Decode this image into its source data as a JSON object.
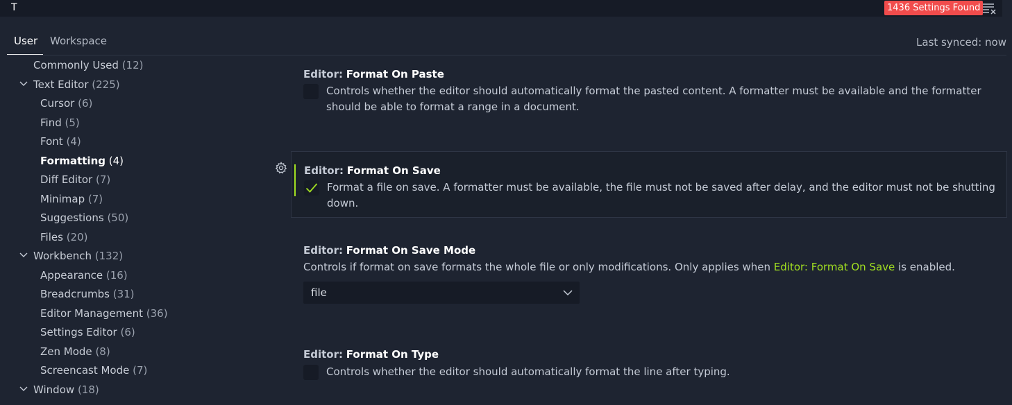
{
  "search": {
    "value": "T",
    "results_badge": "1436 Settings Found"
  },
  "tabs": {
    "user": "User",
    "workspace": "Workspace",
    "sync_status": "Last synced: now"
  },
  "toc": [
    {
      "label": "Commonly Used",
      "count": "(12)"
    },
    {
      "label": "Text Editor",
      "count": "(225)",
      "expanded": true
    },
    {
      "label": "Cursor",
      "count": "(6)"
    },
    {
      "label": "Find",
      "count": "(5)"
    },
    {
      "label": "Font",
      "count": "(4)"
    },
    {
      "label": "Formatting",
      "count": "(4)",
      "active": true
    },
    {
      "label": "Diff Editor",
      "count": "(7)"
    },
    {
      "label": "Minimap",
      "count": "(7)"
    },
    {
      "label": "Suggestions",
      "count": "(50)"
    },
    {
      "label": "Files",
      "count": "(20)"
    },
    {
      "label": "Workbench",
      "count": "(132)",
      "expanded": true
    },
    {
      "label": "Appearance",
      "count": "(16)"
    },
    {
      "label": "Breadcrumbs",
      "count": "(31)"
    },
    {
      "label": "Editor Management",
      "count": "(36)"
    },
    {
      "label": "Settings Editor",
      "count": "(6)"
    },
    {
      "label": "Zen Mode",
      "count": "(8)"
    },
    {
      "label": "Screencast Mode",
      "count": "(7)"
    },
    {
      "label": "Window",
      "count": "(18)",
      "expanded": true
    }
  ],
  "settings": {
    "format_on_paste": {
      "category": "Editor:",
      "name": "Format On Paste",
      "description": "Controls whether the editor should automatically format the pasted content. A formatter must be available and the formatter should be able to format a range in a document.",
      "checked": false
    },
    "format_on_save": {
      "category": "Editor:",
      "name": "Format On Save",
      "description": "Format a file on save. A formatter must be available, the file must not be saved after delay, and the editor must not be shutting down.",
      "checked": true
    },
    "format_on_save_mode": {
      "category": "Editor:",
      "name": "Format On Save Mode",
      "description_before": "Controls if format on save formats the whole file or only modifications. Only applies when",
      "description_link": "Editor: Format On Save",
      "description_after": "is enabled.",
      "value": "file"
    },
    "format_on_type": {
      "category": "Editor:",
      "name": "Format On Type",
      "description": "Controls whether the editor should automatically format the line after typing.",
      "checked": false
    }
  },
  "icons": {
    "clear": "clear-filter-icon",
    "gear": "gear-icon",
    "chevron": "chevron-down-icon",
    "check": "check-icon"
  },
  "colors": {
    "background": "#1e2431",
    "accent": "#a2e021",
    "badge": "#f14c4c",
    "input_background": "#161b26"
  }
}
